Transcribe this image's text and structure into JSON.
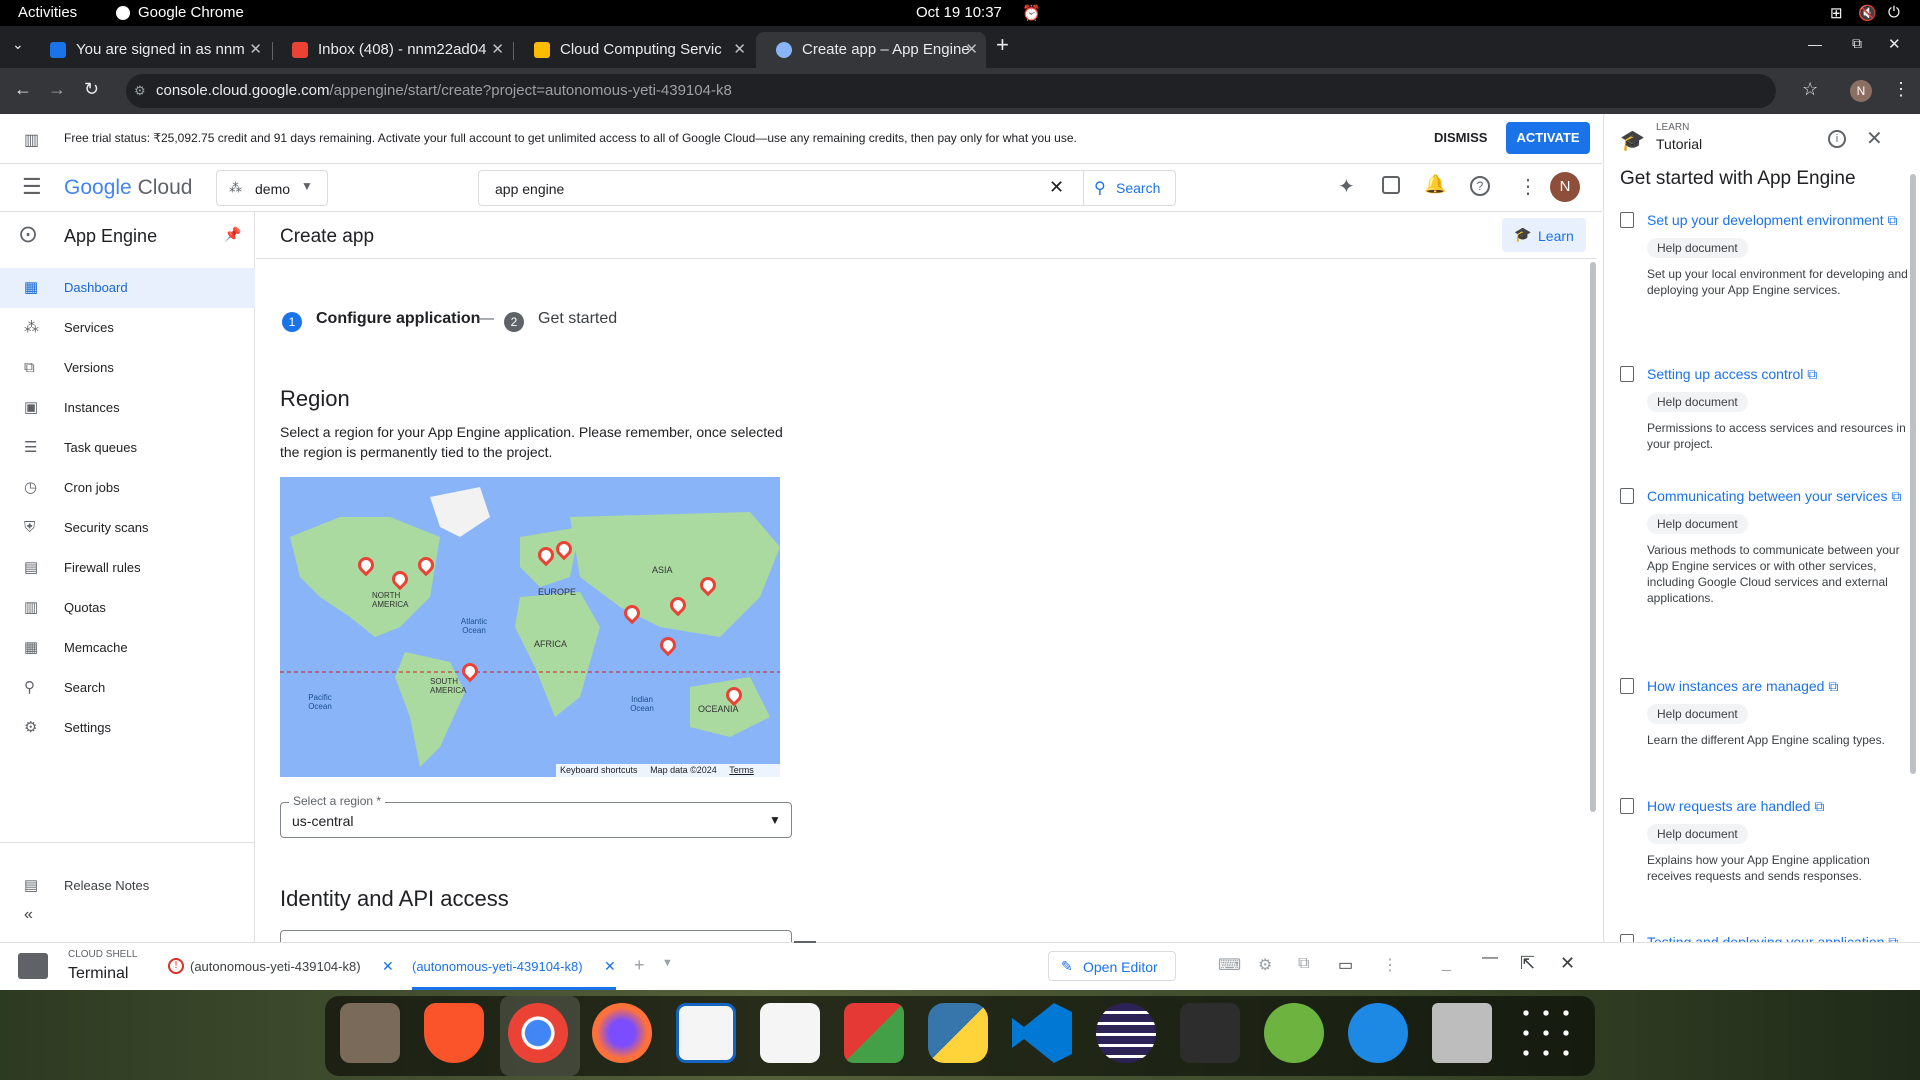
{
  "system": {
    "activities": "Activities",
    "app": "Google Chrome",
    "datetime": "Oct 19  10:37"
  },
  "tabs": [
    {
      "title": "You are signed in as nnm",
      "color": "#1a73e8"
    },
    {
      "title": "Inbox (408) - nnm22ad04",
      "color": "#ea4335"
    },
    {
      "title": "Cloud Computing Servic",
      "color": "#fbbc04"
    },
    {
      "title": "Create app – App Engine",
      "color": "#8ab4f8"
    }
  ],
  "omnibox": {
    "host": "console.cloud.google.com",
    "path": "/appengine/start/create?project=autonomous-yeti-439104-k8"
  },
  "profile_initial": "N",
  "trial": {
    "text": "Free trial status: ₹25,092.75 credit and 91 days remaining. Activate your full account to get unlimited access to all of Google Cloud—use any remaining credits, then pay only for what you use.",
    "dismiss": "DISMISS",
    "activate": "ACTIVATE"
  },
  "header": {
    "logo_google": "Google",
    "logo_cloud": "Cloud",
    "project": "demo",
    "search_value": "app engine",
    "search_btn": "Search"
  },
  "sidebar": {
    "title": "App Engine",
    "items": [
      {
        "label": "Dashboard",
        "icon": "▦"
      },
      {
        "label": "Services",
        "icon": "⁂"
      },
      {
        "label": "Versions",
        "icon": "⧉"
      },
      {
        "label": "Instances",
        "icon": "▣"
      },
      {
        "label": "Task queues",
        "icon": "☰"
      },
      {
        "label": "Cron jobs",
        "icon": "◷"
      },
      {
        "label": "Security scans",
        "icon": "⛨"
      },
      {
        "label": "Firewall rules",
        "icon": "▤"
      },
      {
        "label": "Quotas",
        "icon": "▥"
      },
      {
        "label": "Memcache",
        "icon": "▦"
      },
      {
        "label": "Search",
        "icon": "⚲"
      },
      {
        "label": "Settings",
        "icon": "⚙"
      }
    ],
    "release_notes": "Release Notes"
  },
  "main": {
    "title": "Create app",
    "learn": "Learn",
    "step1_num": "1",
    "step1": "Configure application",
    "step2_num": "2",
    "step2": "Get started",
    "region_heading": "Region",
    "region_desc": "Select a region for your App Engine application. Please remember, once selected the region is permanently tied to the project.",
    "map": {
      "asia": "ASIA",
      "europe": "EUROPE",
      "na": "NORTH AMERICA",
      "africa": "AFRICA",
      "sa": "SOUTH AMERICA",
      "oceania": "OCEANIA",
      "atlantic": "Atlantic Ocean",
      "indian": "Indian Ocean",
      "pacific": "Pacific Ocean",
      "shortcuts": "Keyboard shortcuts",
      "mapdata": "Map data ©2024",
      "terms": "Terms"
    },
    "select_label": "Select a region *",
    "select_value": "us-central",
    "identity_heading": "Identity and API access"
  },
  "tutorial": {
    "learn": "LEARN",
    "title": "Tutorial",
    "heading": "Get started with App Engine",
    "chip": "Help document",
    "items": [
      {
        "link": "Set up your development environment ⧉",
        "desc": "Set up your local environment for developing and deploying your App Engine services."
      },
      {
        "link": "Setting up access control ⧉",
        "desc": "Permissions to access services and resources in your project."
      },
      {
        "link": "Communicating between your services ⧉",
        "desc": "Various methods to communicate between your App Engine services or with other services, including Google Cloud services and external applications."
      },
      {
        "link": "How instances are managed ⧉",
        "desc": "Learn the different App Engine scaling types."
      },
      {
        "link": "How requests are handled ⧉",
        "desc": "Explains how your App Engine application receives requests and sends responses."
      },
      {
        "link": "Testing and deploying your application ⧉",
        "desc": ""
      }
    ]
  },
  "shell": {
    "label": "CLOUD SHELL",
    "title": "Terminal",
    "tab1": "(autonomous-yeti-439104-k8)",
    "tab2": "(autonomous-yeti-439104-k8)",
    "open_editor": "Open Editor"
  },
  "colors": {
    "accent": "#1a73e8",
    "selected_bg": "#e8f0fe",
    "map_water": "#8ab4f8",
    "map_land": "#aadaa0"
  }
}
